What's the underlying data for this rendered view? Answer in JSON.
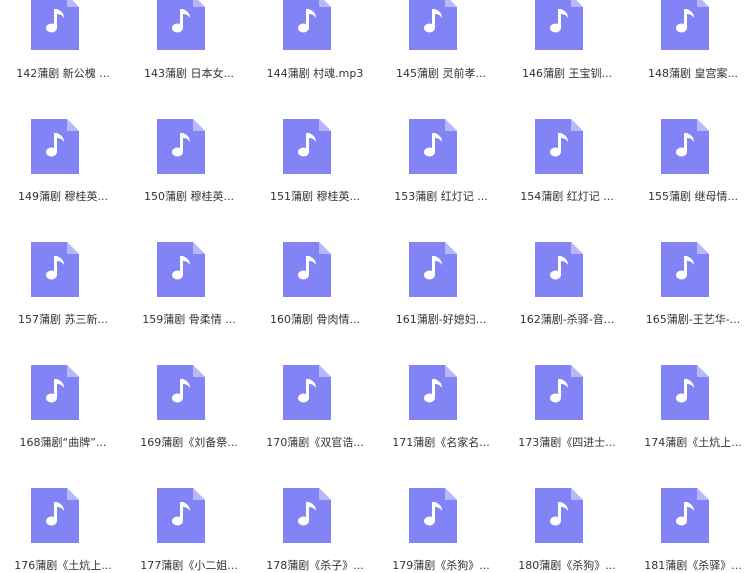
{
  "icon_color": "#8284f5",
  "icon_fold_color": "#b7b8fa",
  "icon_note_color": "#ffffff",
  "files": [
    {
      "name": "142蒲剧 新公槐 ...",
      "icon": "music-file-icon"
    },
    {
      "name": "143蒲剧 日本女...",
      "icon": "music-file-icon"
    },
    {
      "name": "144蒲剧 村魂.mp3",
      "icon": "music-file-icon"
    },
    {
      "name": "145蒲剧 灵前孝...",
      "icon": "music-file-icon"
    },
    {
      "name": "146蒲剧 王宝钏...",
      "icon": "music-file-icon"
    },
    {
      "name": "148蒲剧 皇宫案...",
      "icon": "music-file-icon"
    },
    {
      "name": "149蒲剧 穆桂英...",
      "icon": "music-file-icon"
    },
    {
      "name": "150蒲剧 穆桂英...",
      "icon": "music-file-icon"
    },
    {
      "name": "151蒲剧 穆桂英...",
      "icon": "music-file-icon"
    },
    {
      "name": "153蒲剧 红灯记 ...",
      "icon": "music-file-icon"
    },
    {
      "name": "154蒲剧 红灯记 ...",
      "icon": "music-file-icon"
    },
    {
      "name": "155蒲剧 继母情...",
      "icon": "music-file-icon"
    },
    {
      "name": "157蒲剧 苏三新...",
      "icon": "music-file-icon"
    },
    {
      "name": "159蒲剧 骨柔情 ...",
      "icon": "music-file-icon"
    },
    {
      "name": "160蒲剧 骨肉情...",
      "icon": "music-file-icon"
    },
    {
      "name": "161蒲剧-好媳妇...",
      "icon": "music-file-icon"
    },
    {
      "name": "162蒲剧-杀驿-音...",
      "icon": "music-file-icon"
    },
    {
      "name": "165蒲剧-王艺华-...",
      "icon": "music-file-icon"
    },
    {
      "name": "168蒲剧“曲牌”...",
      "icon": "music-file-icon"
    },
    {
      "name": "169蒲剧《刘备祭...",
      "icon": "music-file-icon"
    },
    {
      "name": "170蒲剧《双官诰...",
      "icon": "music-file-icon"
    },
    {
      "name": "171蒲剧《名家名...",
      "icon": "music-file-icon"
    },
    {
      "name": "173蒲剧《四进士...",
      "icon": "music-file-icon"
    },
    {
      "name": "174蒲剧《土炕上...",
      "icon": "music-file-icon"
    },
    {
      "name": "176蒲剧《土炕上...",
      "icon": "music-file-icon"
    },
    {
      "name": "177蒲剧《小二姐...",
      "icon": "music-file-icon"
    },
    {
      "name": "178蒲剧《杀子》...",
      "icon": "music-file-icon"
    },
    {
      "name": "179蒲剧《杀狗》...",
      "icon": "music-file-icon"
    },
    {
      "name": "180蒲剧《杀狗》...",
      "icon": "music-file-icon"
    },
    {
      "name": "181蒲剧《杀驿》...",
      "icon": "music-file-icon"
    }
  ]
}
